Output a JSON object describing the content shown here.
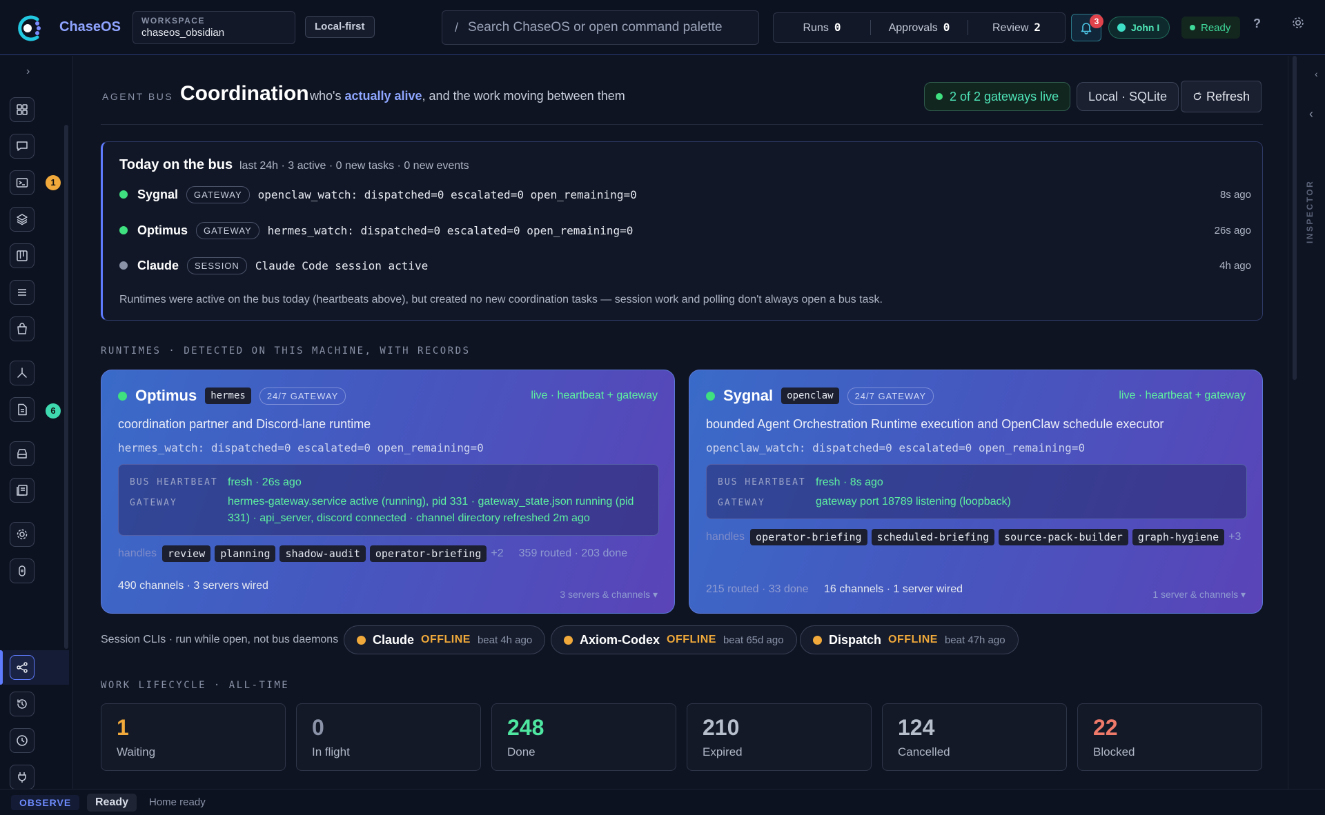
{
  "app": {
    "brand": "ChaseOS",
    "workspace_label": "WORKSPACE",
    "workspace_value": "chaseos_obsidian",
    "mode_pill": "Local-first"
  },
  "search": {
    "slash": "/",
    "placeholder": "Search ChaseOS or open command palette"
  },
  "counters": [
    {
      "label": "Runs",
      "value": "0"
    },
    {
      "label": "Approvals",
      "value": "0"
    },
    {
      "label": "Review",
      "value": "2"
    }
  ],
  "notifications": {
    "count": "3"
  },
  "user": {
    "name": "John I"
  },
  "status": {
    "ready": "Ready",
    "help": "?"
  },
  "sidebar": {
    "collapse": "›",
    "badges": [
      {
        "value": "1",
        "color": "#f0a93a"
      },
      {
        "value": "6",
        "color": "#3fd9b0"
      }
    ]
  },
  "inspector": {
    "label": "INSPECTOR",
    "arrow_top": "‹",
    "arrow": "‹"
  },
  "header": {
    "tag": "AGENT BUS",
    "title": "Coordination",
    "sub_pre": "who's ",
    "sub_hl": "actually alive",
    "sub_post": ", and the work moving between them",
    "gateways": "2 of 2 gateways live",
    "storage": "Local · SQLite",
    "refresh": "Refresh"
  },
  "today": {
    "title": "Today on the bus",
    "meta": "last 24h · 3 active · 0 new tasks · 0 new events",
    "rows": [
      {
        "name": "Sygnal",
        "tag": "GATEWAY",
        "detail": "openclaw_watch: dispatched=0 escalated=0 open_remaining=0",
        "ago": "8s ago",
        "dot": "#3fe07f"
      },
      {
        "name": "Optimus",
        "tag": "GATEWAY",
        "detail": "hermes_watch: dispatched=0 escalated=0 open_remaining=0",
        "ago": "26s ago",
        "dot": "#3fe07f"
      },
      {
        "name": "Claude",
        "tag": "SESSION",
        "detail": "Claude Code session active",
        "ago": "4h ago",
        "dot": "#8a93a8"
      }
    ],
    "note": "Runtimes were active on the bus today (heartbeats above), but created no new coordination tasks — session work and polling don't always open a bus task."
  },
  "runtimes_label": "RUNTIMES · DETECTED ON THIS MACHINE, WITH RECORDS",
  "runtimes": [
    {
      "name": "Optimus",
      "chip": "hermes",
      "kind": "24/7 GATEWAY",
      "live": "live · heartbeat + gateway",
      "desc": "coordination partner and Discord-lane runtime",
      "watch": "hermes_watch: dispatched=0 escalated=0 open_remaining=0",
      "heartbeat_label": "BUS HEARTBEAT",
      "heartbeat": "fresh · 26s ago",
      "gateway_label": "GATEWAY",
      "gateway": "hermes-gateway.service active (running), pid 331 · gateway_state.json running (pid 331) · api_server, discord connected · channel directory refreshed 2m ago",
      "handles_label": "handles",
      "handles": [
        "review",
        "planning",
        "shadow-audit",
        "operator-briefing"
      ],
      "handles_more": "+2",
      "routed": "359 routed · 203 done",
      "wired": "490 channels · 3 servers wired",
      "footer": "3 servers & channels ▾"
    },
    {
      "name": "Sygnal",
      "chip": "openclaw",
      "kind": "24/7 GATEWAY",
      "live": "live · heartbeat + gateway",
      "desc": "bounded Agent Orchestration Runtime execution and OpenClaw schedule executor",
      "watch": "openclaw_watch: dispatched=0 escalated=0 open_remaining=0",
      "heartbeat_label": "BUS HEARTBEAT",
      "heartbeat": "fresh · 8s ago",
      "gateway_label": "GATEWAY",
      "gateway": "gateway port 18789 listening (loopback)",
      "handles_label": "handles",
      "handles": [
        "operator-briefing",
        "scheduled-briefing",
        "source-pack-builder",
        "graph-hygiene"
      ],
      "handles_more": "+3",
      "routed": "215 routed · 33 done",
      "wired": "16 channels · 1 server wired",
      "footer": "1 server & channels ▾"
    }
  ],
  "sessions": {
    "label": "Session CLIs · run while open, not bus daemons",
    "items": [
      {
        "name": "Claude",
        "status": "OFFLINE",
        "beat": "beat 4h ago"
      },
      {
        "name": "Axiom-Codex",
        "status": "OFFLINE",
        "beat": "beat 65d ago"
      },
      {
        "name": "Dispatch",
        "status": "OFFLINE",
        "beat": "beat 47h ago"
      }
    ]
  },
  "lifecycle": {
    "label": "WORK LIFECYCLE · ALL-TIME",
    "stats": [
      {
        "value": "1",
        "label": "Waiting",
        "color": "#f0a93a"
      },
      {
        "value": "0",
        "label": "In flight",
        "color": "#8a93a8"
      },
      {
        "value": "248",
        "label": "Done",
        "color": "#4ee6a0"
      },
      {
        "value": "210",
        "label": "Expired",
        "color": "#b8bfcc"
      },
      {
        "value": "124",
        "label": "Cancelled",
        "color": "#b8bfcc"
      },
      {
        "value": "22",
        "label": "Blocked",
        "color": "#f07a6a"
      }
    ]
  },
  "statusbar": {
    "mode": "OBSERVE",
    "ready": "Ready",
    "home": "Home ready"
  }
}
